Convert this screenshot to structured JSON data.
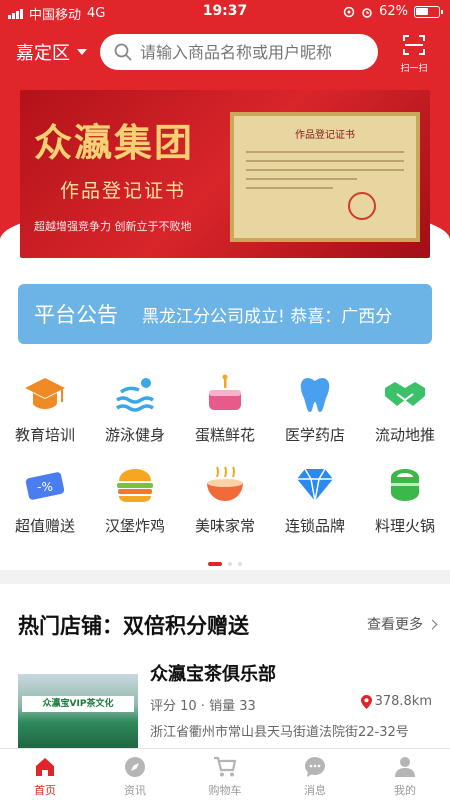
{
  "status_bar": {
    "carrier": "中国移动",
    "network": "4G",
    "time": "19:37",
    "battery": "62%",
    "battery_level": 0.62
  },
  "header": {
    "district": "嘉定区",
    "search_placeholder": "请输入商品名称或用户昵称",
    "scan_label": "扫一扫"
  },
  "banner": {
    "title": "众瀛集团",
    "subtitle": "作品登记证书",
    "slogan": "超越增强竞争力  创新立于不败地",
    "certificate_title": "作品登记证书"
  },
  "notice": {
    "title": "平台公告",
    "text": "黑龙江分公司成立!   恭喜：广西分"
  },
  "categories": [
    {
      "label": "教育培训",
      "icon": "graduation-cap-icon",
      "color": "#f08a24"
    },
    {
      "label": "游泳健身",
      "icon": "swimming-icon",
      "color": "#3aa8e8"
    },
    {
      "label": "蛋糕鲜花",
      "icon": "cake-icon",
      "color": "#e85a8a"
    },
    {
      "label": "医学药店",
      "icon": "tooth-icon",
      "color": "#4aa0f0"
    },
    {
      "label": "流动地推",
      "icon": "handshake-icon",
      "color": "#3cc06a"
    },
    {
      "label": "超值赠送",
      "icon": "coupon-icon",
      "color": "#4a7ef0"
    },
    {
      "label": "汉堡炸鸡",
      "icon": "burger-icon",
      "color": "#f07a2a"
    },
    {
      "label": "美味家常",
      "icon": "bowl-icon",
      "color": "#f06a3a"
    },
    {
      "label": "连锁品牌",
      "icon": "diamond-icon",
      "color": "#2a8af0"
    },
    {
      "label": "料理火锅",
      "icon": "sushi-icon",
      "color": "#3cb84a"
    }
  ],
  "hot": {
    "title": "热门店铺：双倍积分赠送",
    "more": "查看更多",
    "shop": {
      "name": "众瀛宝茶俱乐部",
      "meta": "评分 10 · 销量 33",
      "distance": "378.8km",
      "address": "浙江省衢州市常山县天马街道法院街22-32号",
      "sign": "众瀛宝VIP茶文化"
    }
  },
  "tabs": [
    {
      "label": "首页",
      "icon": "home-icon"
    },
    {
      "label": "资讯",
      "icon": "compass-icon"
    },
    {
      "label": "购物车",
      "icon": "cart-icon"
    },
    {
      "label": "消息",
      "icon": "message-icon"
    },
    {
      "label": "我的",
      "icon": "user-icon"
    }
  ],
  "colors": {
    "brand": "#e0262a",
    "notice": "#6cb4e6"
  }
}
